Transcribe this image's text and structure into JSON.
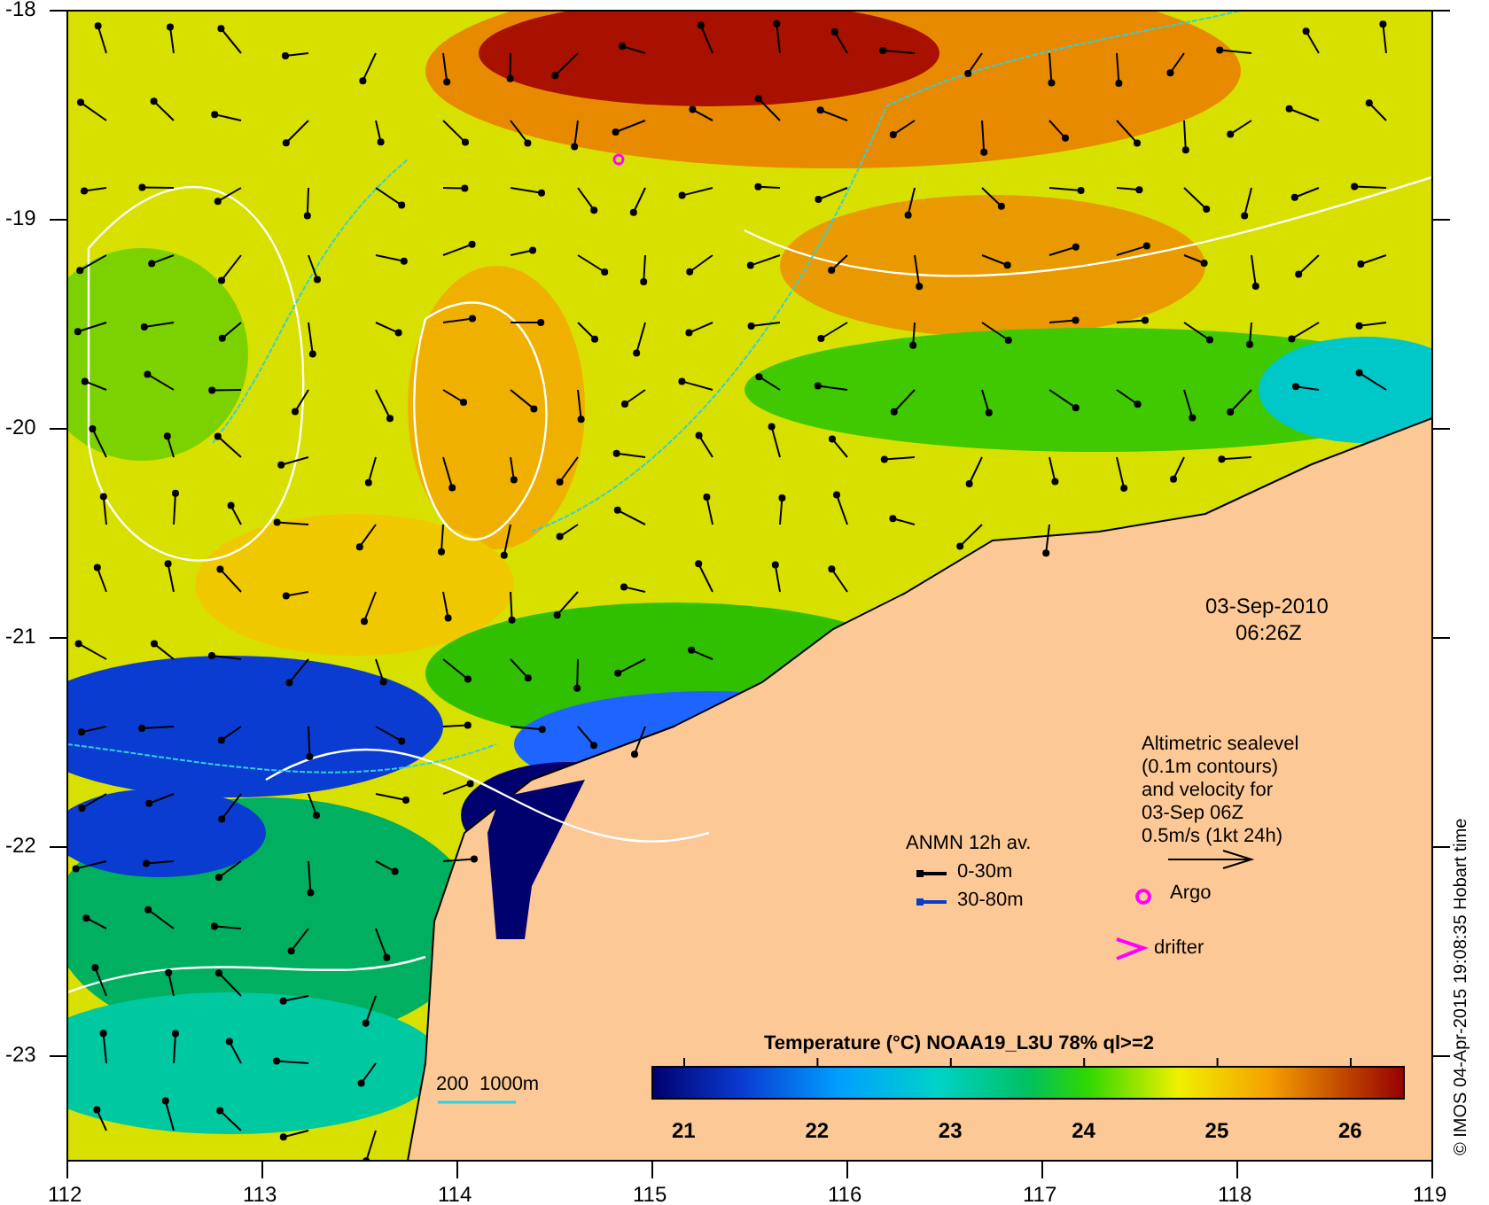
{
  "plot": {
    "y_ticks": [
      "-18",
      "-19",
      "-20",
      "-21",
      "-22",
      "-23"
    ],
    "x_ticks": [
      "112",
      "113",
      "114",
      "115",
      "116",
      "117",
      "118",
      "119"
    ],
    "timestamp": {
      "date": "03-Sep-2010",
      "time": "06:26Z"
    },
    "altimetry_note": "Altimetric sealevel\n(0.1m contours)\nand velocity for\n03-Sep 06Z\n0.5m/s (1kt 24h)",
    "anmn_legend": {
      "title": "ANMN 12h av.",
      "items": [
        {
          "label": "0-30m",
          "color": "#000000"
        },
        {
          "label": "30-80m",
          "color": "#0a3cc8"
        }
      ]
    },
    "argo_label": "Argo",
    "drifter_label": "drifter",
    "isobath_label": "200  1000m",
    "colorbar": {
      "title": "Temperature (°C) NOAA19_L3U 78% ql>=2",
      "ticks": [
        "21",
        "22",
        "23",
        "24",
        "25",
        "26"
      ]
    },
    "credit": "© IMOS 04-Apr-2015 19:08:35 Hobart time"
  }
}
